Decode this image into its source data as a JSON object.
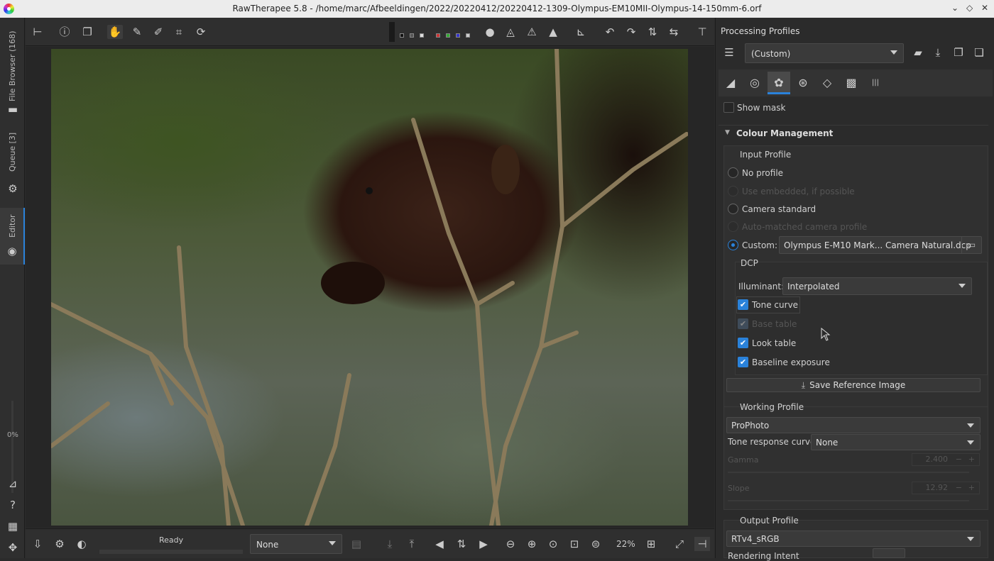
{
  "window": {
    "title": "RawTherapee 5.8 - /home/marc/Afbeeldingen/2022/20220412/20220412-1309-Olympus-EM10MII-Olympus-14-150mm-6.orf",
    "min": "⌄",
    "max": "◇",
    "close": "✕"
  },
  "sidebar": {
    "file_browser": "File Browser (168)",
    "queue": "Queue [3]",
    "editor": "Editor",
    "progress": "0%"
  },
  "viewer": {
    "status": "Ready",
    "preset_select": "None",
    "zoom": "22%"
  },
  "right": {
    "processing_profiles": "Processing Profiles",
    "profile_value": "(Custom)",
    "show_mask": "Show mask",
    "colour_management": "Colour Management",
    "input_profile": "Input Profile",
    "no_profile": "No profile",
    "use_embedded": "Use embedded, if possible",
    "camera_standard": "Camera standard",
    "auto_matched": "Auto-matched camera profile",
    "custom": "Custom:",
    "custom_file": "Olympus E-M10 Mark... Camera Natural.dcp",
    "dcp": "DCP",
    "illuminant": "Illuminant:",
    "illuminant_value": "Interpolated",
    "tone_curve": "Tone curve",
    "base_table": "Base table",
    "look_table": "Look table",
    "baseline_exposure": "Baseline exposure",
    "save_reference": "Save Reference Image",
    "working_profile": "Working Profile",
    "working_value": "ProPhoto",
    "trc_label": "Tone response curve:",
    "trc_value": "None",
    "gamma": "Gamma",
    "gamma_value": "2.400",
    "slope": "Slope",
    "slope_value": "12.92",
    "output_profile": "Output Profile",
    "output_value": "RTv4_sRGB",
    "rendering_intent": "Rendering Intent"
  }
}
